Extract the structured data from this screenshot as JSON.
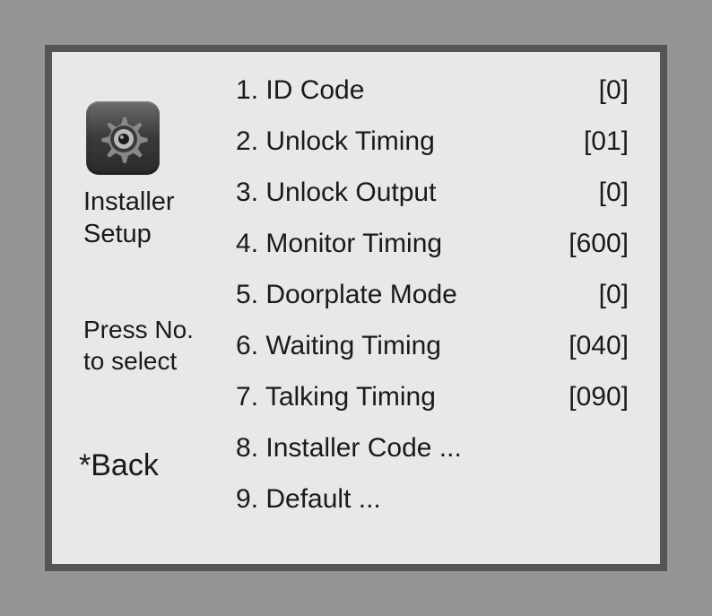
{
  "sidebar": {
    "title_line1": "Installer",
    "title_line2": "Setup",
    "hint_line1": "Press No.",
    "hint_line2": "to select",
    "back_label": "*Back",
    "icon_name": "gear-icon"
  },
  "menu": {
    "items": [
      {
        "num": "1",
        "label": "ID Code",
        "value": "[0]"
      },
      {
        "num": "2",
        "label": "Unlock Timing",
        "value": "[01]"
      },
      {
        "num": "3",
        "label": "Unlock Output",
        "value": "[0]"
      },
      {
        "num": "4",
        "label": "Monitor Timing",
        "value": "[600]"
      },
      {
        "num": "5",
        "label": "Doorplate Mode",
        "value": "[0]"
      },
      {
        "num": "6",
        "label": "Waiting Timing",
        "value": "[040]"
      },
      {
        "num": "7",
        "label": "Talking Timing",
        "value": "[090]"
      },
      {
        "num": "8",
        "label": "Installer Code ...",
        "value": ""
      },
      {
        "num": "9",
        "label": "Default ...",
        "value": ""
      }
    ]
  }
}
